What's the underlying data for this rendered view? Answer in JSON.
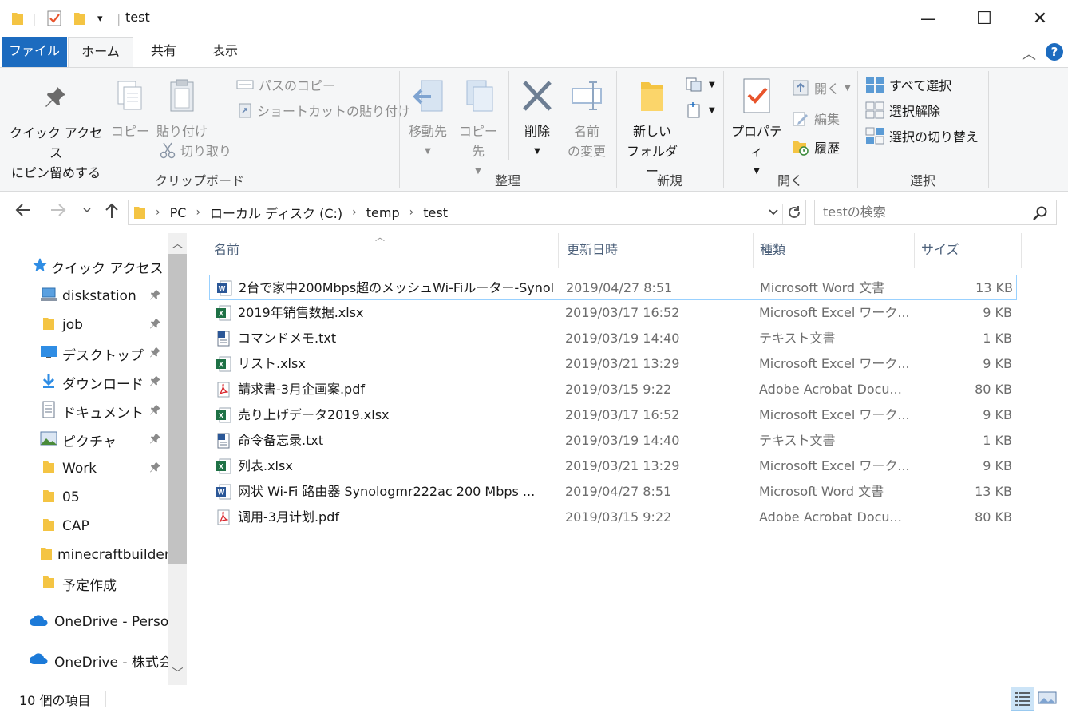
{
  "window": {
    "title": "test",
    "dropdown_glyph": "▾",
    "minimize_glyph": "—",
    "maximize_glyph": "☐",
    "close_glyph": "✕"
  },
  "tabs": {
    "file": "ファイル",
    "home": "ホーム",
    "share": "共有",
    "view": "表示",
    "collapse_glyph": "︿",
    "help": "?"
  },
  "ribbon": {
    "clipboard": {
      "group": "クリップボード",
      "pin_line1": "クイック アクセス",
      "pin_line2": "にピン留めする",
      "copy": "コピー",
      "paste": "貼り付け",
      "copy_path": "パスのコピー",
      "paste_shortcut": "ショートカットの貼り付け",
      "cut": "切り取り"
    },
    "organize": {
      "group": "整理",
      "move_to": "移動先",
      "copy_to": "コピー先",
      "delete": "削除",
      "rename_line1": "名前",
      "rename_line2": "の変更"
    },
    "new": {
      "group": "新規",
      "new_folder_line1": "新しい",
      "new_folder_line2": "フォルダー"
    },
    "open": {
      "group": "開く",
      "properties": "プロパティ",
      "open": "開く",
      "edit": "編集",
      "history": "履歴"
    },
    "select": {
      "group": "選択",
      "select_all": "すべて選択",
      "select_none": "選択解除",
      "invert": "選択の切り替え"
    }
  },
  "address": {
    "crumbs": [
      "PC",
      "ローカル ディスク (C:)",
      "temp",
      "test"
    ],
    "search_placeholder": "testの検索"
  },
  "navpane": {
    "quick_access": "クイック アクセス",
    "items": [
      {
        "label": "diskstation",
        "pinned": true
      },
      {
        "label": "job",
        "pinned": true
      },
      {
        "label": "デスクトップ",
        "pinned": true
      },
      {
        "label": "ダウンロード",
        "pinned": true
      },
      {
        "label": "ドキュメント",
        "pinned": true
      },
      {
        "label": "ピクチャ",
        "pinned": true
      },
      {
        "label": "Work",
        "pinned": true
      },
      {
        "label": "05",
        "pinned": false
      },
      {
        "label": "CAP",
        "pinned": false
      },
      {
        "label": "minecraftbuilder",
        "pinned": false
      },
      {
        "label": "予定作成",
        "pinned": false
      }
    ],
    "onedrive_personal": "OneDrive - Person",
    "onedrive_company": "OneDrive - 株式会"
  },
  "filelist": {
    "columns": {
      "name": "名前",
      "modified": "更新日時",
      "type": "種類",
      "size": "サイズ"
    },
    "rows": [
      {
        "name": "2台で家中200Mbps超のメッシュWi-Fiルーター-Synol...",
        "modified": "2019/04/27 8:51",
        "type": "Microsoft Word 文書",
        "size": "13 KB",
        "icon": "word"
      },
      {
        "name": "2019年销售数据.xlsx",
        "modified": "2019/03/17 16:52",
        "type": "Microsoft Excel ワーク...",
        "size": "9 KB",
        "icon": "excel"
      },
      {
        "name": "コマンドメモ.txt",
        "modified": "2019/03/19 14:40",
        "type": "テキスト文書",
        "size": "1 KB",
        "icon": "text"
      },
      {
        "name": "リスト.xlsx",
        "modified": "2019/03/21 13:29",
        "type": "Microsoft Excel ワーク...",
        "size": "9 KB",
        "icon": "excel"
      },
      {
        "name": "請求書-3月企画案.pdf",
        "modified": "2019/03/15 9:22",
        "type": "Adobe Acrobat Docu...",
        "size": "80 KB",
        "icon": "pdf"
      },
      {
        "name": "売り上げデータ2019.xlsx",
        "modified": "2019/03/17 16:52",
        "type": "Microsoft Excel ワーク...",
        "size": "9 KB",
        "icon": "excel"
      },
      {
        "name": "命令备忘录.txt",
        "modified": "2019/03/19 14:40",
        "type": "テキスト文書",
        "size": "1 KB",
        "icon": "text"
      },
      {
        "name": "列表.xlsx",
        "modified": "2019/03/21 13:29",
        "type": "Microsoft Excel ワーク...",
        "size": "9 KB",
        "icon": "excel"
      },
      {
        "name": "网状 Wi-Fi 路由器 Synologmr222ac 200 Mbps ...",
        "modified": "2019/04/27 8:51",
        "type": "Microsoft Word 文書",
        "size": "13 KB",
        "icon": "word"
      },
      {
        "name": "调用-3月计划.pdf",
        "modified": "2019/03/15 9:22",
        "type": "Adobe Acrobat Docu...",
        "size": "80 KB",
        "icon": "pdf"
      }
    ]
  },
  "status": {
    "item_count": "10 個の項目"
  },
  "colors": {
    "accent": "#1c6bbf",
    "folder": "#f4c443",
    "word": "#2b5797",
    "excel": "#1e7145",
    "pdf": "#d9272e",
    "selection_border": "#99d1ff"
  }
}
